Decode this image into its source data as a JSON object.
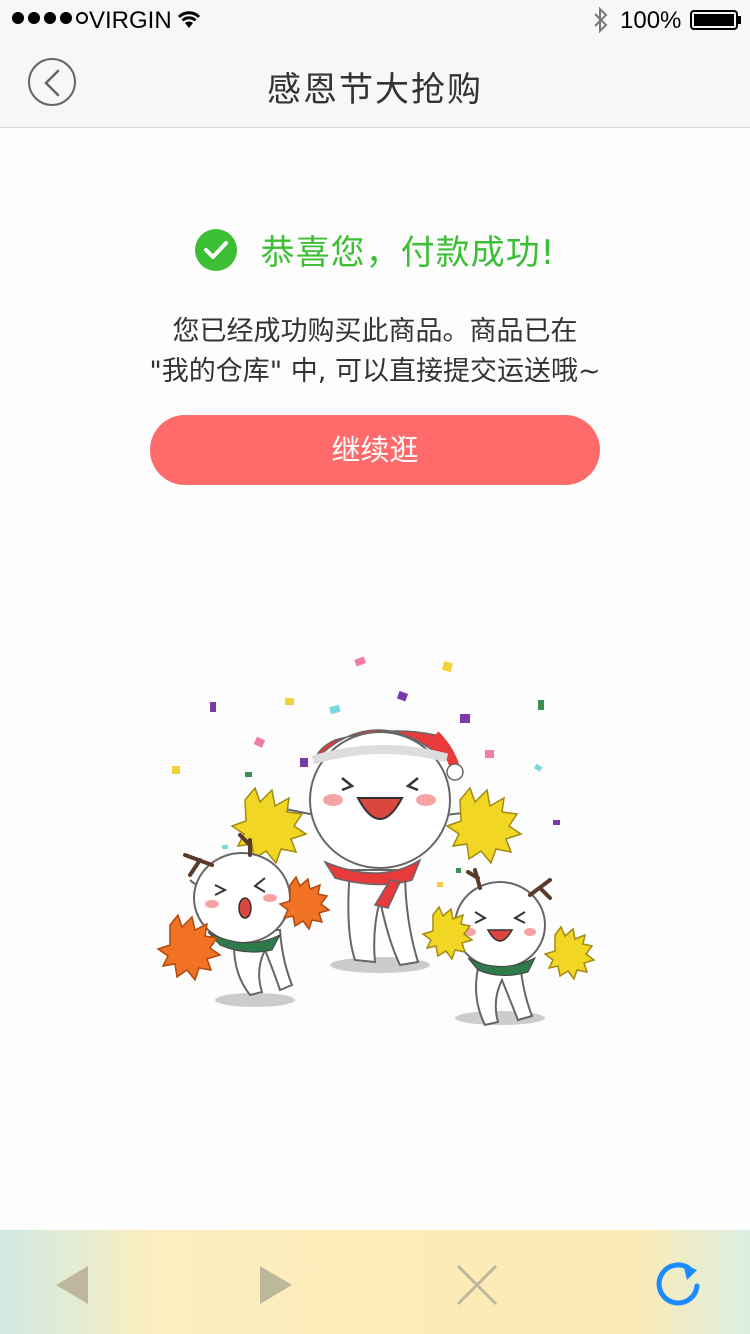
{
  "status_bar": {
    "carrier": "VIRGIN",
    "battery": "100%",
    "icons": [
      "signal-dots",
      "wifi-icon",
      "bluetooth-icon",
      "battery-icon"
    ]
  },
  "nav": {
    "title": "感恩节大抢购",
    "back_icon": "chevron-left-icon"
  },
  "result": {
    "title": "恭喜您，付款成功!",
    "line1": "您已经成功购买此商品。商品已在",
    "line2": "\"我的仓库\" 中, 可以直接提交运送哦~",
    "button_label": "继续逛"
  },
  "toolbar": {
    "icons": [
      "back-arrow-icon",
      "forward-arrow-icon",
      "close-icon",
      "refresh-icon"
    ]
  },
  "colors": {
    "success_green": "#3cbf34",
    "button_red": "#ff6b6b",
    "refresh_blue": "#1a8cff"
  }
}
